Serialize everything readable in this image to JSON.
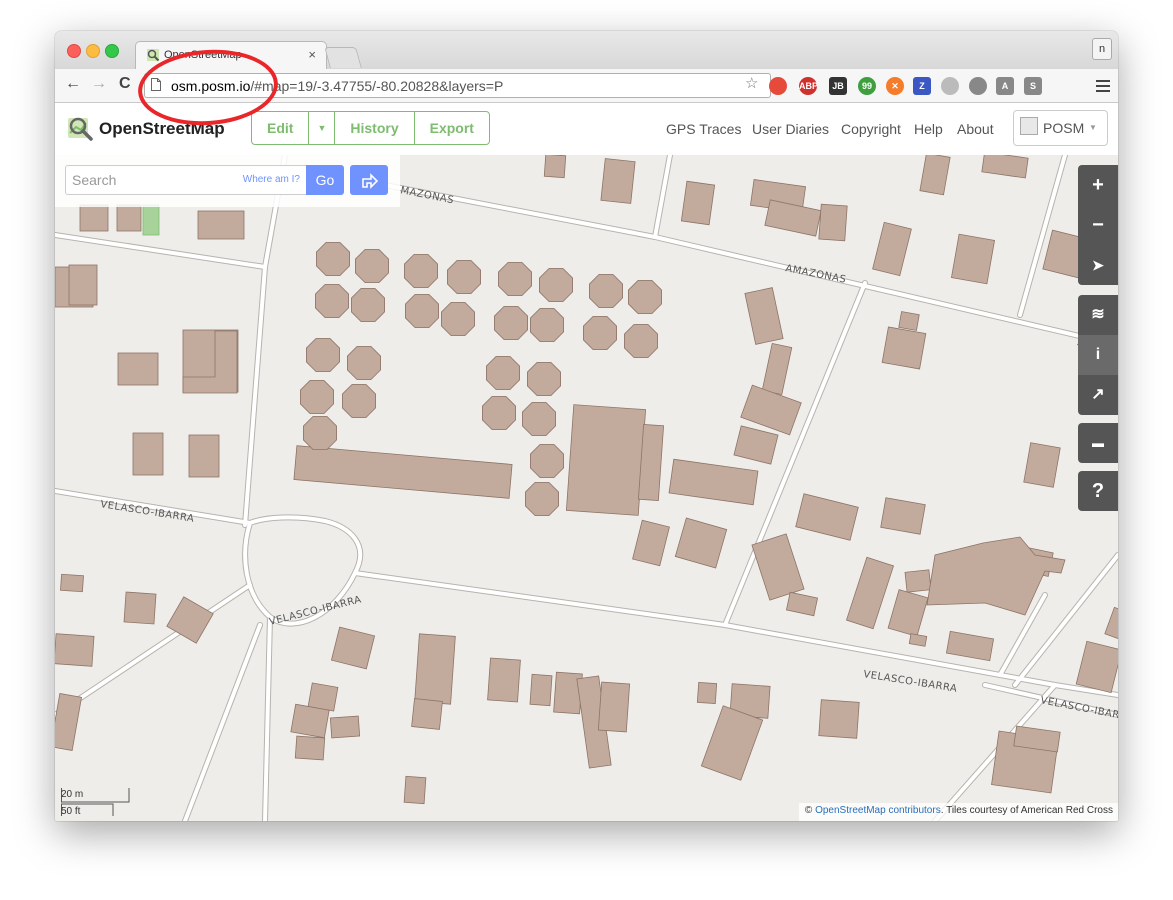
{
  "browser": {
    "tab_title": "OpenStreetMap",
    "tab_close": "×",
    "profile_letter": "n",
    "url_host": "osm.posm.io",
    "url_rest": "/#map=19/-3.47755/-80.20828&layers=P",
    "back": "←",
    "forward": "→",
    "reload": "C",
    "star": "☆",
    "extensions": [
      {
        "name": "color-wheel-icon",
        "label": "",
        "color": "#e64a3b"
      },
      {
        "name": "adblock-plus-icon",
        "label": "ABP",
        "color": "#d0312d"
      },
      {
        "name": "jetbrains-icon",
        "label": "JB",
        "color": "#333333"
      },
      {
        "name": "speech-bubble-icon",
        "label": "99",
        "color": "#3f9f3f"
      },
      {
        "name": "orange-extension-icon",
        "label": "✕",
        "color": "#f47c2a"
      },
      {
        "name": "zotero-icon",
        "label": "Z",
        "color": "#3b57c4"
      },
      {
        "name": "spinner-icon",
        "label": "",
        "color": "#bbbbbb"
      },
      {
        "name": "record-icon",
        "label": "",
        "color": "#888888"
      },
      {
        "name": "angular-icon",
        "label": "A",
        "color": "#888888"
      },
      {
        "name": "s-extension-icon",
        "label": "S",
        "color": "#888888"
      }
    ]
  },
  "header": {
    "brand": "OpenStreetMap",
    "edit_label": "Edit",
    "edit_caret": "▼",
    "history_label": "History",
    "export_label": "Export",
    "nav": [
      "GPS Traces",
      "User Diaries",
      "Copyright",
      "Help",
      "About"
    ],
    "account": "POSM",
    "account_caret": "▼"
  },
  "search": {
    "placeholder": "Search",
    "where_am_i": "Where am I?",
    "go_label": "Go"
  },
  "map_controls": {
    "zoom_in": "+",
    "zoom_out": "−",
    "locate": "➤",
    "layers": "≋",
    "info": "i",
    "share": "↗",
    "note": "▬",
    "query": "?"
  },
  "map": {
    "street_labels": [
      "MAZONAS",
      "AMAZONAS",
      "AMAZO",
      "VELASCO-IBARRA",
      "VELASCO-IBARRA",
      "VELASCO-IBARRA",
      "VELASCO-IBAR"
    ],
    "colors": {
      "background": "#efedea",
      "building": "#c2aa9d",
      "building_stroke": "#8d7467",
      "road": "#ffffff",
      "road_casing": "#b7b3ad",
      "park": "#a7d39a"
    }
  },
  "scale": {
    "metric": "20 m",
    "imperial": "50 ft"
  },
  "attribution": {
    "prefix": "© ",
    "link": "OpenStreetMap contributors",
    "suffix": ". Tiles courtesy of American Red Cross"
  },
  "annotation": {
    "color": "#e9262a"
  }
}
